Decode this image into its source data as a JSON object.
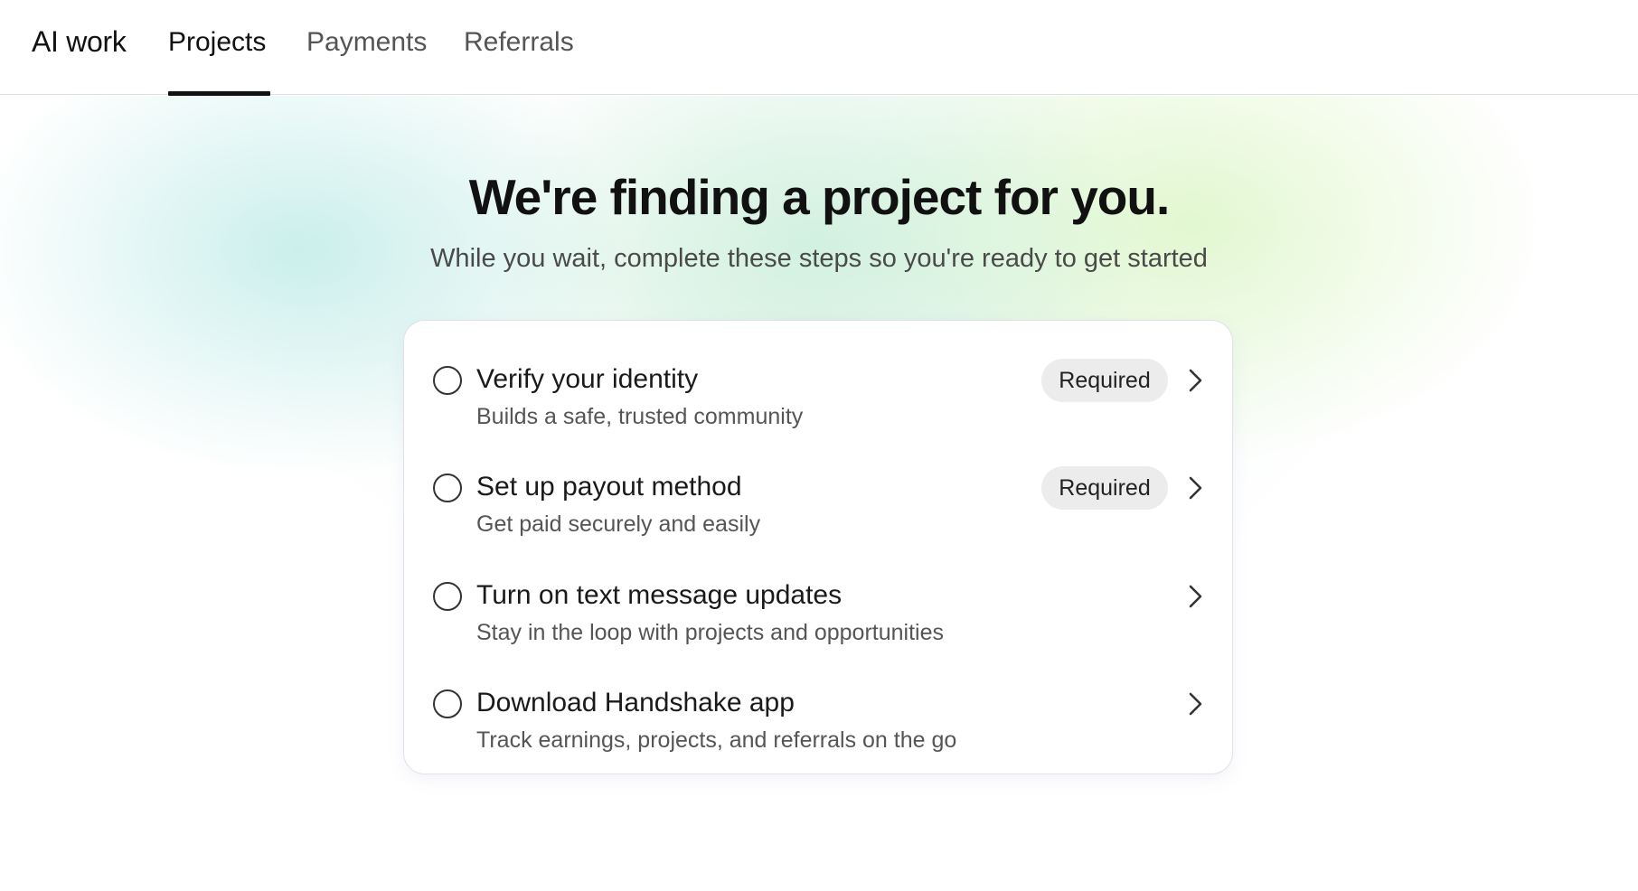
{
  "nav": {
    "brand": "AI work",
    "tabs": [
      {
        "label": "Projects",
        "active": true
      },
      {
        "label": "Payments",
        "active": false
      },
      {
        "label": "Referrals",
        "active": false
      }
    ]
  },
  "hero": {
    "title": "We're finding a project for you.",
    "subtitle": "While you wait, complete these steps so you're ready to get started"
  },
  "steps": [
    {
      "title": "Verify your identity",
      "description": "Builds a safe, trusted community",
      "badge": "Required",
      "icon": "chevron-right-icon"
    },
    {
      "title": "Set up payout method",
      "description": "Get paid securely and easily",
      "badge": "Required",
      "icon": "chevron-right-icon"
    },
    {
      "title": "Turn on text message updates",
      "description": "Stay in the loop with projects and opportunities",
      "badge": "",
      "icon": "chevron-right-icon"
    },
    {
      "title": "Download Handshake app",
      "description": "Track earnings, projects, and referrals on the go",
      "badge": "",
      "icon": "chevron-right-icon"
    }
  ],
  "colors": {
    "text_primary": "#111111",
    "text_secondary": "#555555",
    "badge_bg": "#ececec",
    "divider": "#dedede"
  }
}
